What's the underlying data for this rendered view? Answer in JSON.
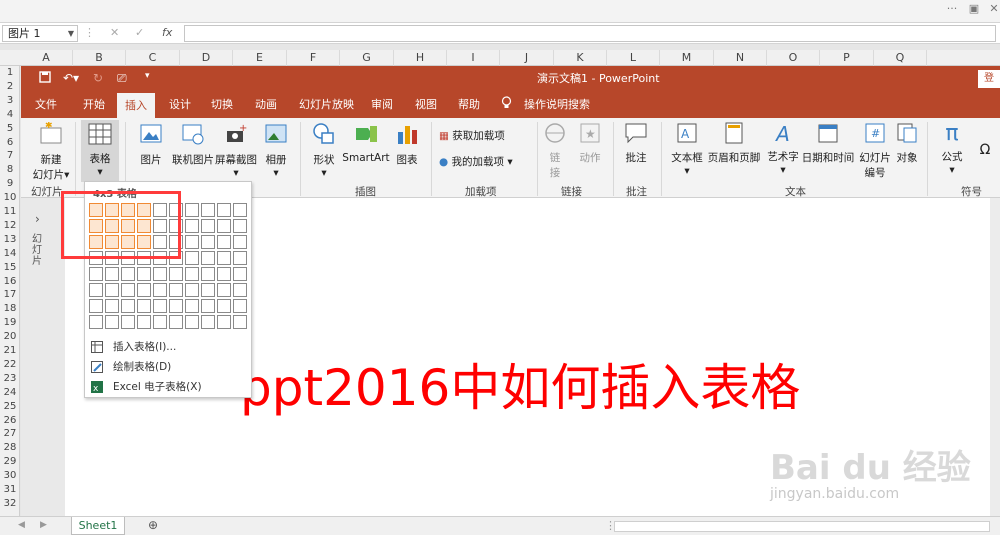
{
  "excel": {
    "name_box": "图片 1",
    "columns": [
      "A",
      "B",
      "C",
      "D",
      "E",
      "F",
      "G",
      "H",
      "I",
      "J",
      "K",
      "L",
      "M",
      "N",
      "O",
      "P",
      "Q"
    ],
    "rows": [
      "1",
      "2",
      "3",
      "4",
      "5",
      "6",
      "7",
      "8",
      "9",
      "10",
      "11",
      "12",
      "13",
      "14",
      "15",
      "16",
      "17",
      "18",
      "19",
      "20",
      "21",
      "22",
      "23",
      "24",
      "25",
      "26",
      "27",
      "28",
      "29",
      "30",
      "31",
      "32"
    ],
    "sheet_tab": "Sheet1",
    "fx": "fx"
  },
  "ppt": {
    "title": "演示文稿1  -  PowerPoint",
    "login": "登",
    "tabs": [
      "文件",
      "开始",
      "插入",
      "设计",
      "切换",
      "动画",
      "幻灯片放映",
      "审阅",
      "视图",
      "帮助"
    ],
    "tell_me": "操作说明搜索",
    "ribbon": {
      "new_slide": [
        "新建",
        "幻灯片"
      ],
      "table": "表格",
      "picture": "图片",
      "online_picture": "联机图片",
      "screenshot": "屏幕截图",
      "album": "相册",
      "shapes": "形状",
      "smartart": "SmartArt",
      "chart": "图表",
      "get_addins": "获取加载项",
      "my_addins": "我的加载项",
      "link": [
        "链",
        "接"
      ],
      "action": "动作",
      "comment": "批注",
      "textbox": "文本框",
      "header_footer": "页眉和页脚",
      "wordart": "艺术字",
      "datetime": "日期和时间",
      "slide_number": [
        "幻灯片",
        "编号"
      ],
      "object": "对象",
      "equation": "公式",
      "symbol": "Ω",
      "groups": [
        "幻灯片",
        "插图",
        "加载项",
        "链接",
        "批注",
        "文本",
        "符号"
      ]
    },
    "thumb_label": "幻灯片"
  },
  "table_dropdown": {
    "grid_label": "4x3 表格",
    "cols": 10,
    "rows": 8,
    "selected_cols": 4,
    "selected_rows": 3,
    "items": [
      "插入表格(I)...",
      "绘制表格(D)",
      "Excel 电子表格(X)"
    ]
  },
  "overlay_text": "ppt2016中如何插入表格",
  "watermark": {
    "brand": "Bai  du 经验",
    "url": "jingyan.baidu.com"
  },
  "colors": {
    "ppt_accent": "#b7472a",
    "overlay": "#ff0000",
    "grid_highlight": "#f08a34",
    "highlight_box": "#ff3b3b"
  }
}
